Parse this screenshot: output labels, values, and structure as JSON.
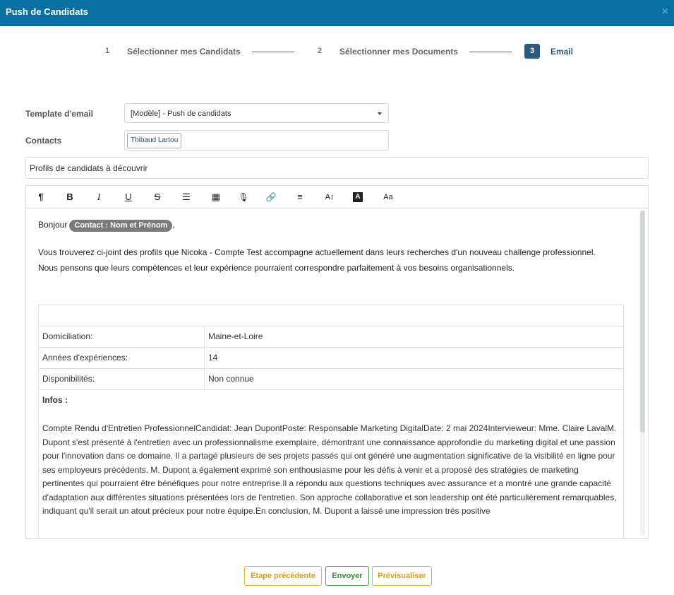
{
  "header": {
    "title": "Push de Candidats",
    "close_icon": "close-icon"
  },
  "stepper": {
    "steps": [
      {
        "number": "1",
        "label": "Sélectionner mes Candidats"
      },
      {
        "number": "2",
        "label": "Sélectionner mes Documents"
      },
      {
        "number": "3",
        "label": "Email",
        "active": true
      }
    ]
  },
  "form": {
    "template_label": "Template d'email",
    "template_value": "[Modèle] - Push de candidats",
    "contacts_label": "Contacts",
    "contacts": [
      "Thibaud Lartou"
    ],
    "subject": "Profils de candidats à découvrir"
  },
  "toolbar": {
    "icons": [
      "paragraph-icon",
      "bold-icon",
      "italic-icon",
      "underline-icon",
      "strikethrough-icon",
      "bullet-list-icon",
      "table-icon",
      "microphone-icon",
      "link-icon",
      "align-icon",
      "font-size-icon",
      "text-color-icon",
      "font-family-icon"
    ],
    "glyphs": [
      "¶",
      "B",
      "I",
      "U",
      "S",
      "☰",
      "▦",
      "🎙",
      "🔗",
      "≡",
      "A↕",
      "A",
      "Aa"
    ]
  },
  "email": {
    "greeting": "Bonjour",
    "contact_tag": "Contact : Nom et Prénom",
    "greeting_end": ",",
    "paragraph1": "Vous trouverez ci-joint des profils que Nicoka - Compte Test accompagne actuellement dans leurs recherches d'un nouveau challenge professionnel.",
    "paragraph2": "Nous pensons que leurs compétences et leur expérience pourraient correspondre parfaitement à vos besoins organisationnels.",
    "profile": {
      "rows": [
        {
          "key": "Domiciliation:",
          "value": "Maine-et-Loire"
        },
        {
          "key": "Années d'expériences:",
          "value": "14"
        },
        {
          "key": "Disponibilités:",
          "value": "Non connue"
        }
      ],
      "infos_title": "Infos :",
      "infos_text": "Compte Rendu d'Entretien ProfessionnelCandidat: Jean DupontPoste: Responsable Marketing DigitalDate: 2 mai 2024Intervieweur: Mme. Claire LavalM. Dupont s'est présenté à l'entretien avec un professionnalisme exemplaire, démontrant une connaissance approfondie du marketing digital et une passion pour l'innovation dans ce domaine. Il a partagé plusieurs de ses projets passés qui ont généré une augmentation significative de la visibilité en ligne pour ses employeurs précédents. M. Dupont a également exprimé son enthousiasme pour les défis à venir et a proposé des stratégies de marketing pertinentes qui pourraient être bénéfiques pour notre entreprise.Il a répondu aux questions techniques avec assurance et a montré une grande capacité d'adaptation aux différentes situations présentées lors de l'entretien. Son approche collaborative et son leadership ont été particulièrement remarquables, indiquant qu'il serait un atout précieux pour notre équipe.En conclusion, M. Dupont a laissé une impression très positive"
    }
  },
  "buttons": {
    "prev": "Etape précédente",
    "send": "Envoyer",
    "preview": "Prévisualiser"
  }
}
